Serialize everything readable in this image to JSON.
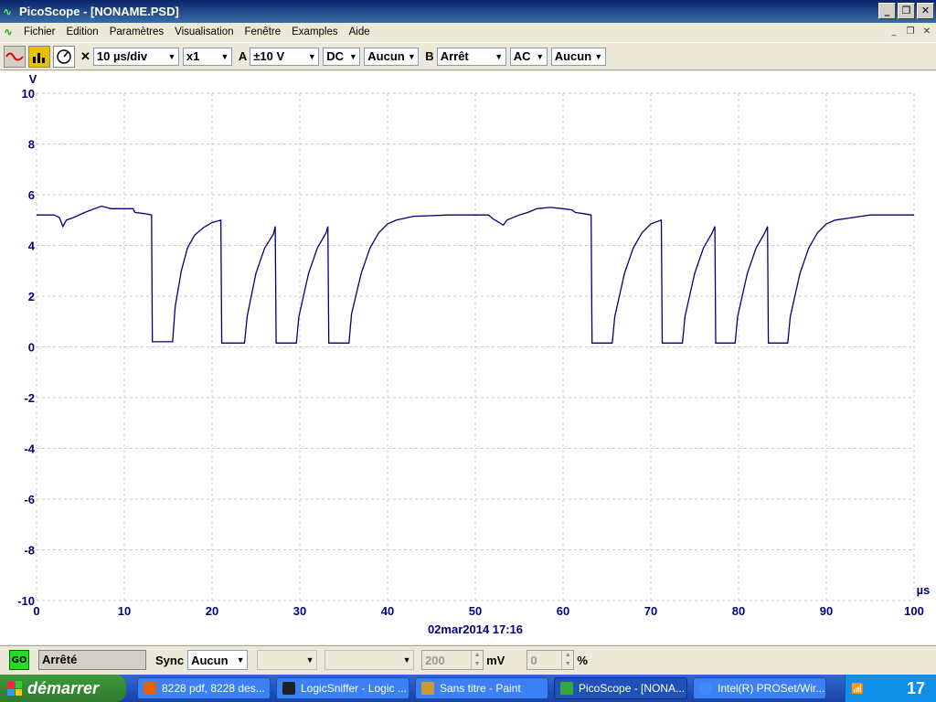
{
  "window": {
    "title": "PicoScope - [NONAME.PSD]"
  },
  "menu": {
    "items": [
      "Fichier",
      "Edition",
      "Paramètres",
      "Visualisation",
      "Fenêtre",
      "Examples",
      "Aide"
    ]
  },
  "toolbar": {
    "timebase": "10 µs/div",
    "mult": "x1",
    "channel_a_label": "A",
    "channel_a_range": "±10 V",
    "channel_a_coupling": "DC",
    "channel_a_filter": "Aucun",
    "channel_b_label": "B",
    "channel_b_range": "Arrêt",
    "channel_b_coupling": "AC",
    "channel_b_filter": "Aucun"
  },
  "chart_data": {
    "type": "line",
    "ylabel": "V",
    "xlabel": "µs",
    "xlim": [
      0,
      100
    ],
    "ylim": [
      -10,
      10
    ],
    "x_ticks": [
      "0",
      "10",
      "20",
      "30",
      "40",
      "50",
      "60",
      "70",
      "80",
      "90",
      "100"
    ],
    "y_ticks": [
      "10",
      "8",
      "6",
      "4",
      "2",
      "0",
      "-2",
      "-4",
      "-6",
      "-8",
      "-10"
    ],
    "grid": true,
    "timestamp": "02mar2014  17:16",
    "series": [
      {
        "color": "#00007f",
        "points": [
          [
            0,
            5.2
          ],
          [
            2,
            5.2
          ],
          [
            2.6,
            5.1
          ],
          [
            3.0,
            4.75
          ],
          [
            3.4,
            5.0
          ],
          [
            4.2,
            5.1
          ],
          [
            5.5,
            5.3
          ],
          [
            6.6,
            5.45
          ],
          [
            7.4,
            5.55
          ],
          [
            8.5,
            5.45
          ],
          [
            10,
            5.45
          ],
          [
            11,
            5.45
          ],
          [
            11.2,
            5.3
          ],
          [
            12.4,
            5.25
          ],
          [
            13.1,
            5.2
          ],
          [
            13.2,
            0.2
          ],
          [
            15.5,
            0.2
          ],
          [
            15.8,
            1.6
          ],
          [
            16.5,
            3.0
          ],
          [
            17.2,
            3.9
          ],
          [
            18,
            4.4
          ],
          [
            19,
            4.7
          ],
          [
            20,
            4.9
          ],
          [
            21,
            5.0
          ],
          [
            21.1,
            0.15
          ],
          [
            23.7,
            0.15
          ],
          [
            24,
            1.2
          ],
          [
            25,
            2.9
          ],
          [
            26,
            3.9
          ],
          [
            27,
            4.45
          ],
          [
            27.2,
            4.75
          ],
          [
            27.3,
            0.15
          ],
          [
            29.6,
            0.15
          ],
          [
            29.9,
            1.2
          ],
          [
            31,
            2.9
          ],
          [
            32,
            3.9
          ],
          [
            33,
            4.5
          ],
          [
            33.2,
            4.75
          ],
          [
            33.3,
            0.15
          ],
          [
            35.6,
            0.15
          ],
          [
            35.9,
            1.3
          ],
          [
            37,
            2.9
          ],
          [
            38,
            3.9
          ],
          [
            39,
            4.5
          ],
          [
            40,
            4.85
          ],
          [
            41,
            5.0
          ],
          [
            43,
            5.15
          ],
          [
            47,
            5.2
          ],
          [
            51.5,
            5.2
          ],
          [
            52,
            5.05
          ],
          [
            53.2,
            4.8
          ],
          [
            53.6,
            5.0
          ],
          [
            55,
            5.2
          ],
          [
            56,
            5.3
          ],
          [
            57,
            5.45
          ],
          [
            58.5,
            5.5
          ],
          [
            60,
            5.45
          ],
          [
            61,
            5.4
          ],
          [
            61.4,
            5.3
          ],
          [
            62.4,
            5.25
          ],
          [
            63.2,
            5.2
          ],
          [
            63.3,
            0.15
          ],
          [
            65.6,
            0.15
          ],
          [
            65.9,
            1.2
          ],
          [
            67,
            2.9
          ],
          [
            68,
            3.9
          ],
          [
            69,
            4.5
          ],
          [
            70,
            4.85
          ],
          [
            71.2,
            5.0
          ],
          [
            71.3,
            0.15
          ],
          [
            73.6,
            0.15
          ],
          [
            73.9,
            1.2
          ],
          [
            75,
            2.9
          ],
          [
            76,
            3.9
          ],
          [
            77,
            4.5
          ],
          [
            77.3,
            4.75
          ],
          [
            77.4,
            0.15
          ],
          [
            79.6,
            0.15
          ],
          [
            79.9,
            1.2
          ],
          [
            81,
            2.9
          ],
          [
            82,
            3.9
          ],
          [
            83,
            4.5
          ],
          [
            83.3,
            4.75
          ],
          [
            83.4,
            0.15
          ],
          [
            85.6,
            0.15
          ],
          [
            85.9,
            1.2
          ],
          [
            87,
            2.9
          ],
          [
            88,
            3.9
          ],
          [
            89,
            4.5
          ],
          [
            90,
            4.85
          ],
          [
            91,
            5.0
          ],
          [
            93,
            5.1
          ],
          [
            95,
            5.2
          ],
          [
            100,
            5.2
          ]
        ]
      }
    ]
  },
  "status": {
    "state": "Arrêté",
    "go_label": "GO",
    "sync_label": "Sync",
    "sync_value": "Aucun",
    "threshold_value": "200",
    "threshold_unit": "mV",
    "percent_value": "0",
    "percent_unit": "%"
  },
  "taskbar": {
    "start_label": "démarrer",
    "tasks": [
      "8228 pdf, 8228 des...",
      "LogicSniffer - Logic ...",
      "Sans titre - Paint",
      "PicoScope - [NONA...",
      "Intel(R) PROSet/Wir..."
    ],
    "clock": "17"
  }
}
